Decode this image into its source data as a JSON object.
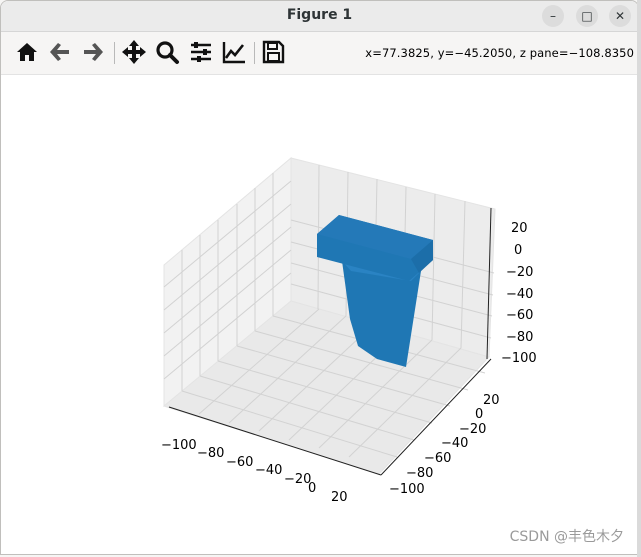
{
  "window": {
    "title": "Figure 1",
    "minimize_icon": "minimize-icon",
    "maximize_icon": "maximize-icon",
    "close_icon": "close-icon"
  },
  "toolbar": {
    "tools": [
      {
        "name": "home-button",
        "icon": "home-icon"
      },
      {
        "name": "back-button",
        "icon": "arrow-left-icon"
      },
      {
        "name": "forward-button",
        "icon": "arrow-right-icon"
      },
      {
        "name": "pan-button",
        "icon": "move-icon"
      },
      {
        "name": "zoom-button",
        "icon": "magnifier-icon"
      },
      {
        "name": "subplots-button",
        "icon": "sliders-icon"
      },
      {
        "name": "axes-edit-button",
        "icon": "line-chart-icon"
      },
      {
        "name": "save-button",
        "icon": "floppy-disk-icon"
      }
    ],
    "coordinates": "x=77.3825, y=−45.2050, z pane=−108.8350"
  },
  "plot": {
    "x_ticks": [
      "−100",
      "−80",
      "−60",
      "−40",
      "−20",
      "0",
      "20"
    ],
    "y_ticks": [
      "−100",
      "−80",
      "−60",
      "−40",
      "−20",
      "0",
      "20"
    ],
    "z_ticks": [
      "20",
      "0",
      "−20",
      "−40",
      "−60",
      "−80",
      "−100"
    ],
    "surface_color": "#1f77b4",
    "pane_color": "#f2f2f2",
    "grid_color": "#d4d4d4"
  },
  "watermark": "CSDN @丰色木夕"
}
